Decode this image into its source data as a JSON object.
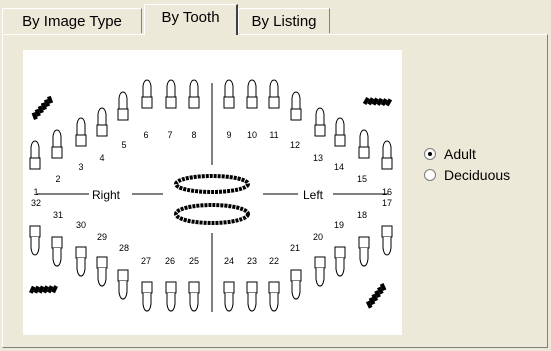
{
  "tabs": [
    {
      "label": "By Image Type",
      "active": false
    },
    {
      "label": "By Tooth",
      "active": true
    },
    {
      "label": "By Listing",
      "active": false
    }
  ],
  "chart": {
    "right_label": "Right",
    "left_label": "Left",
    "upper_numbers": [
      "1",
      "2",
      "3",
      "4",
      "5",
      "6",
      "7",
      "8",
      "9",
      "10",
      "11",
      "12",
      "13",
      "14",
      "15",
      "16"
    ],
    "lower_numbers": [
      "32",
      "31",
      "30",
      "29",
      "28",
      "27",
      "26",
      "25",
      "24",
      "23",
      "22",
      "21",
      "20",
      "19",
      "18",
      "17"
    ]
  },
  "dentition": {
    "options": [
      {
        "label": "Adult",
        "selected": true
      },
      {
        "label": "Deciduous",
        "selected": false
      }
    ]
  }
}
